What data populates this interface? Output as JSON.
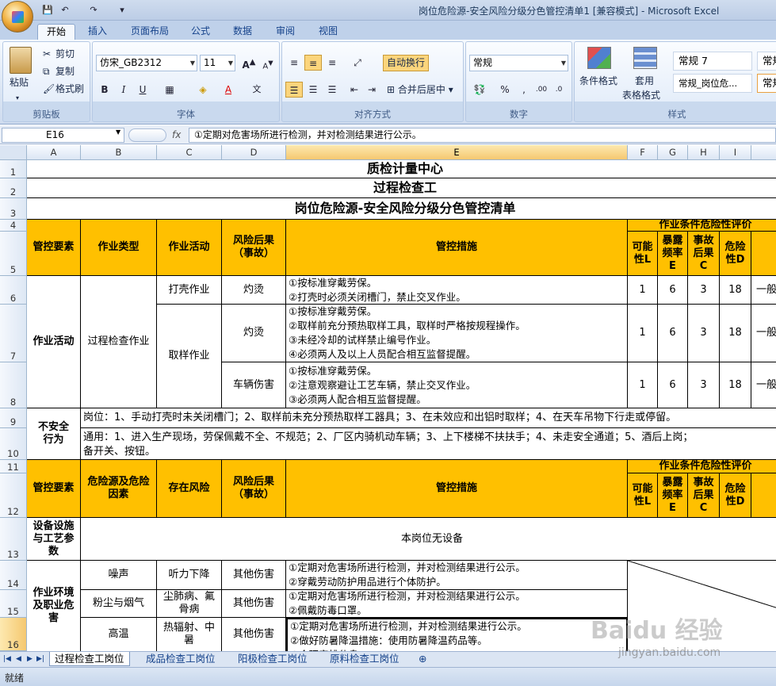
{
  "window": {
    "title": "岗位危险源-安全风险分级分色管控清单1  [兼容模式] - Microsoft Excel"
  },
  "ribbon": {
    "tabs": [
      "开始",
      "插入",
      "页面布局",
      "公式",
      "数据",
      "审阅",
      "视图"
    ],
    "clipboard": {
      "paste": "粘贴",
      "cut": "剪切",
      "copy": "复制",
      "format_painter": "格式刷",
      "label": "剪贴板"
    },
    "font": {
      "name": "仿宋_GB2312",
      "size": "11",
      "label": "字体",
      "bold": "B",
      "italic": "I",
      "underline": "U"
    },
    "alignment": {
      "wrap": "自动换行",
      "merge": "合并后居中",
      "label": "对齐方式"
    },
    "number": {
      "format": "常规",
      "label": "数字"
    },
    "styles": {
      "conditional": "条件格式",
      "table_format_1": "套用",
      "table_format_2": "表格格式",
      "cell1": "常规 7",
      "cell2": "常规_岗位危...",
      "cell3": "常规",
      "cell4": "常规",
      "label": "样式"
    }
  },
  "formula_bar": {
    "cell_ref": "E16",
    "fx": "fx",
    "value": "①定期对危害场所进行检测，并对检测结果进行公示。"
  },
  "grid": {
    "columns": [
      "A",
      "B",
      "C",
      "D",
      "E",
      "F",
      "G",
      "H",
      "I"
    ],
    "rows": [
      "1",
      "2",
      "3",
      "4",
      "5",
      "6",
      "7",
      "8",
      "9",
      "10",
      "11",
      "12",
      "13",
      "14",
      "15",
      "16"
    ],
    "title1": "质检计量中心",
    "title2": "过程检查工",
    "title3": "岗位危险源-安全风险分级分色管控清单",
    "hdr": {
      "control": "管控要素",
      "work_type": "作业类型",
      "activity": "作业活动",
      "consequence": "风险后果（事故）",
      "measures": "管控措施",
      "eval": "作业条件危险性评价",
      "L": "可能性L",
      "E": "暴露频率E",
      "C": "事故后果C",
      "D": "危险性D"
    },
    "work": {
      "element": "作业活动",
      "type": "过程检查作业",
      "act1": "打壳作业",
      "act2": "取样作业",
      "cons1": "灼烫",
      "cons2": "灼烫",
      "cons3": "车辆伤害",
      "m1": "①按标准穿戴劳保。\n②打壳时必须关闭槽门，禁止交叉作业。",
      "m2": "①按标准穿戴劳保。\n②取样前充分预热取样工具，取样时严格按规程操作。\n③未经冷却的试样禁止编号作业。\n④必须两人及以上人员配合相互监督提醒。",
      "m3": "①按标准穿戴劳保。\n②注意观察避让工艺车辆，禁止交叉作业。\n③必须两人配合相互监督提醒。",
      "r1": [
        "1",
        "6",
        "3",
        "18"
      ],
      "r2": [
        "1",
        "6",
        "3",
        "18"
      ],
      "r3": [
        "1",
        "6",
        "3",
        "18"
      ],
      "level": "一般"
    },
    "unsafe": {
      "element": "不安全行为",
      "post": "岗位：1、手动打壳时未关闭槽门；2、取样前未充分预热取样工器具；3、在未效应和出铝时取样；4、在天车吊物下行走或停留。",
      "general": "通用：1、进入生产现场，劳保佩戴不全、不规范；2、厂区内骑机动车辆；3、上下楼梯不扶扶手；4、未走安全通道；5、酒后上岗；\n备开关、按钮。"
    },
    "hdr2": {
      "hazard": "危险源及危险因素",
      "risk": "存在风险"
    },
    "equipment": {
      "element": "设备设施与工艺参数",
      "note": "本岗位无设备"
    },
    "env": {
      "element": "作业环境及职业危害",
      "h1": "噪声",
      "risk1": "听力下降",
      "cons1": "其他伤害",
      "m1": "①定期对危害场所进行检测，并对检测结果进行公示。\n②穿戴劳动防护用品进行个体防护。",
      "h2": "粉尘与烟气",
      "risk2": "尘肺病、氟骨病",
      "cons2": "其他伤害",
      "m2": "①定期对危害场所进行检测，并对检测结果进行公示。\n②佩戴防毒口罩。",
      "h3": "高温",
      "risk3": "热辐射、中暑",
      "cons3": "其他伤害",
      "m3": "①定期对危害场所进行检测，并对检测结果进行公示。\n②做好防暑降温措施：使用防暑降温药品等。\n③合理安排休息。"
    }
  },
  "sheets": [
    "过程检查工岗位",
    "成品检查工岗位",
    "阳极检查工岗位",
    "原料检查工岗位"
  ],
  "status": "就绪",
  "watermark": {
    "brand": "Baidu 经验",
    "url": "jingyan.baidu.com"
  },
  "colors": {
    "header_orange": "#ffc000",
    "ribbon_blue": "#dbe6f4"
  }
}
